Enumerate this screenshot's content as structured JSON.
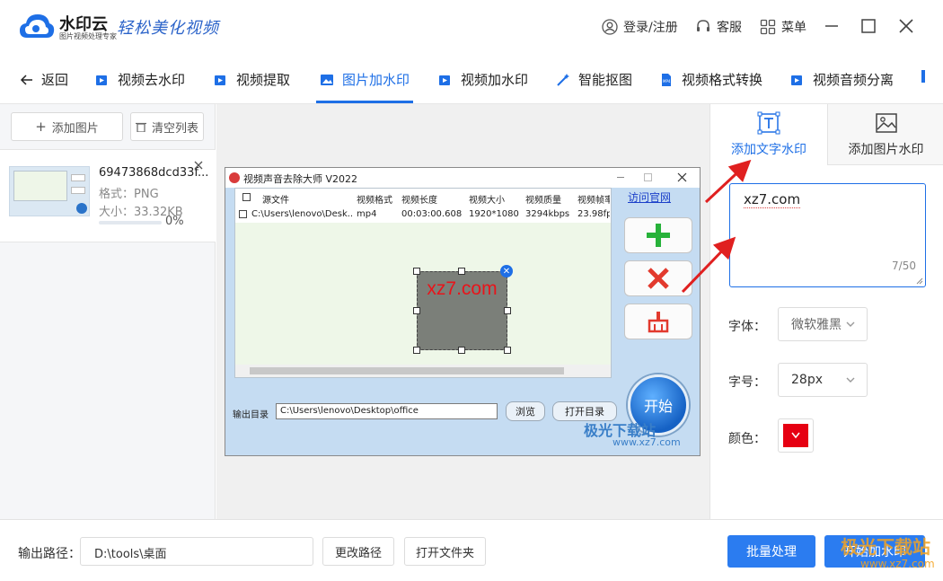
{
  "app": {
    "name": "水印云",
    "subtitle": "图片视频处理专家",
    "slogan": "轻松美化视频",
    "login": "登录/注册",
    "service": "客服",
    "menu": "菜单"
  },
  "nav": {
    "back": "返回",
    "items": [
      "视频去水印",
      "视频提取",
      "图片加水印",
      "视频加水印",
      "智能抠图",
      "视频格式转换",
      "视频音频分离"
    ],
    "active_index": 2
  },
  "left": {
    "add_image": "添加图片",
    "clear_list": "清空列表",
    "file": {
      "name": "69473868dcd33f...",
      "format": "格式：PNG",
      "size": "大小：33.32KB",
      "progress_text": "0%",
      "progress": 0
    }
  },
  "canvas": {
    "window_title": "视频声音去除大师 V2022",
    "visit_site": "访问官网",
    "columns": [
      "源文件",
      "视频格式",
      "视频长度",
      "视频大小",
      "视频质量",
      "视频帧率"
    ],
    "row": [
      "C:\\Users\\lenovo\\Desk...",
      "mp4",
      "00:03:00.608",
      "1920*1080",
      "3294kbps",
      "23.98fps"
    ],
    "output_label": "输出目录",
    "output_path": "C:\\Users\\lenovo\\Desktop\\office",
    "browse": "浏览",
    "open_dir": "打开目录",
    "start": "开始",
    "watermark_text": "xz7.com",
    "site_brand": "极光下载站",
    "site_url": "www.xz7.com"
  },
  "right": {
    "tab_text": "添加文字水印",
    "tab_image": "添加图片水印",
    "text_value": "xz7.com",
    "char_count": "7/50",
    "font_label": "字体：",
    "font_value": "微软雅黑",
    "size_label": "字号：",
    "size_value": "28px",
    "color_label": "颜色：",
    "color_value": "#e60012"
  },
  "footer": {
    "output_label": "输出路径：",
    "output_path": "D:\\tools\\桌面",
    "change_path": "更改路径",
    "open_folder": "打开文件夹",
    "batch": "批量处理",
    "start": "开始加水印",
    "brand": "极光下载站",
    "brand_url": "www.xz7.com"
  },
  "colors": {
    "accent": "#1e6fe6",
    "primary_button": "#2b7cf0",
    "watermark_red": "#e8141a"
  }
}
